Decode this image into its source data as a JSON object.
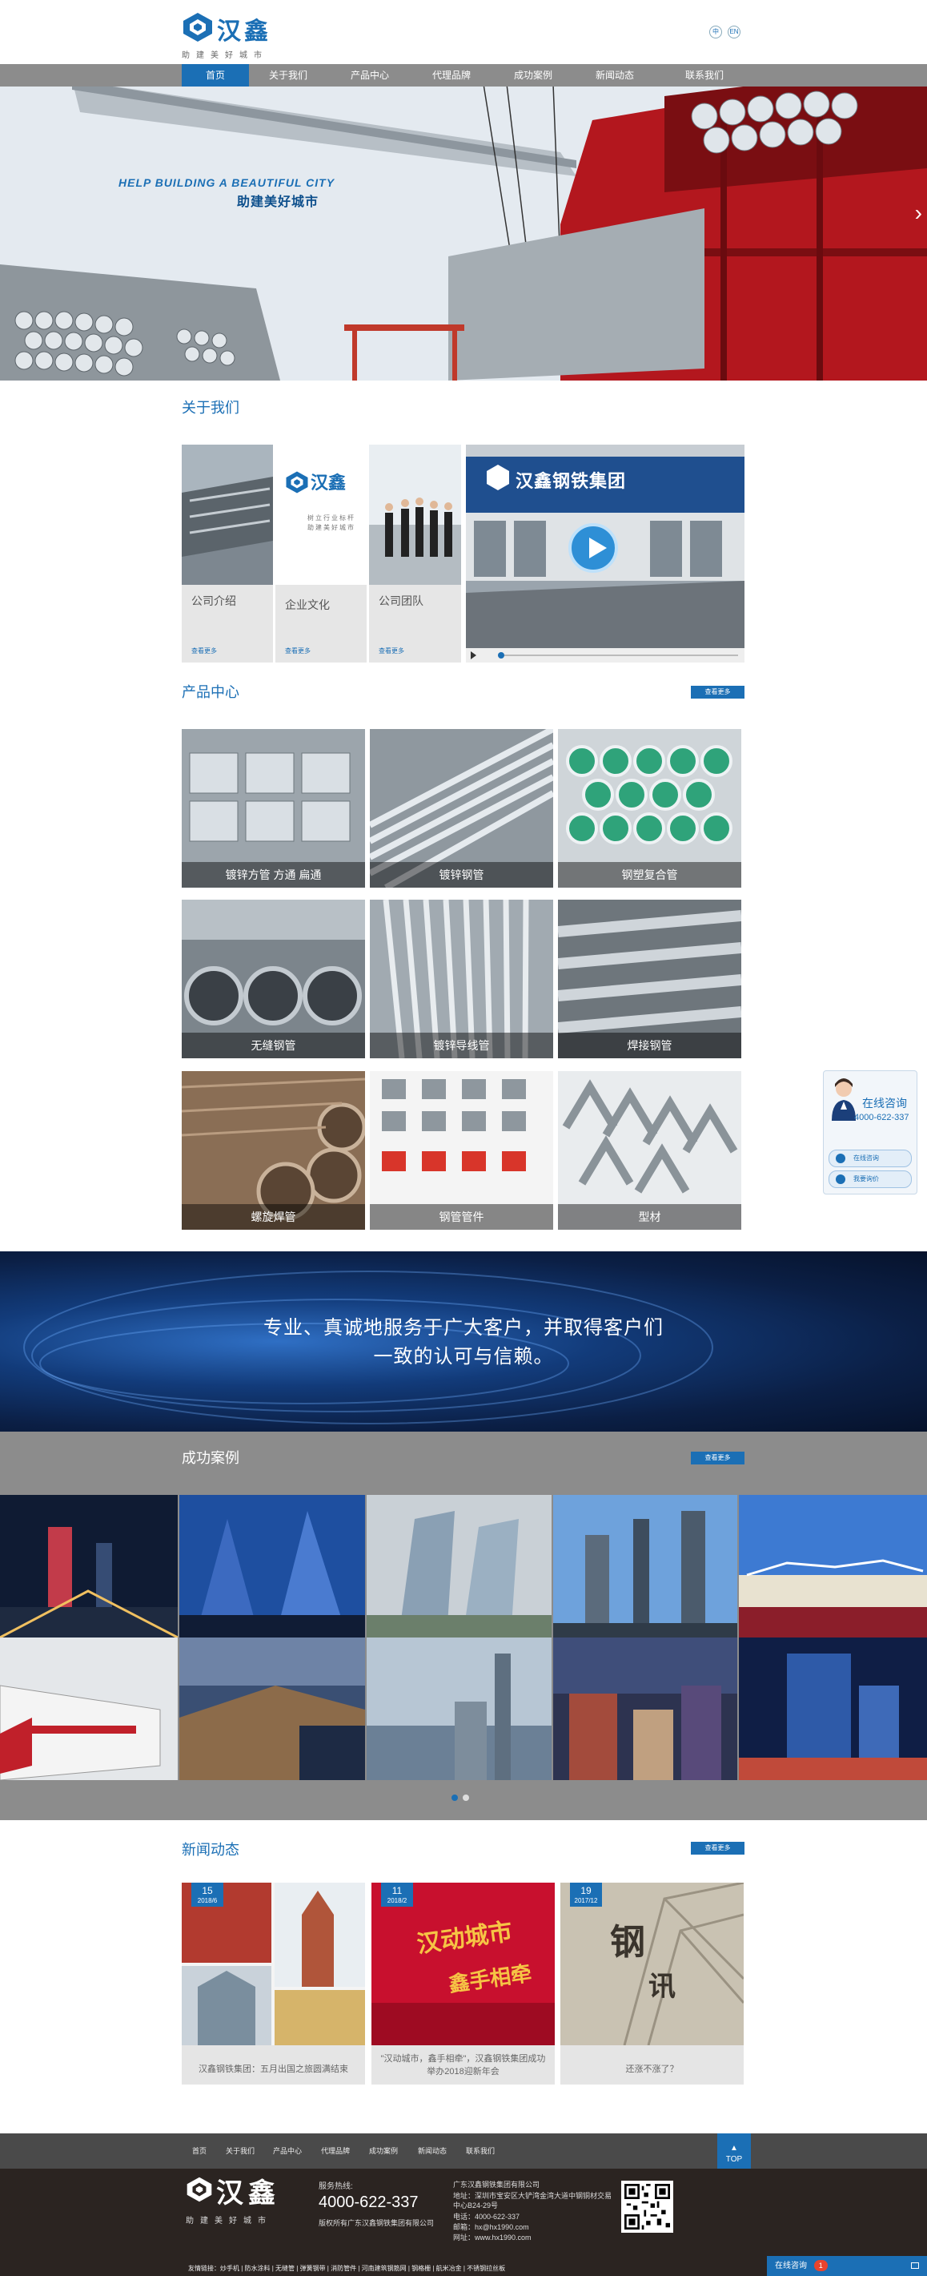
{
  "header": {
    "logo_text": "汉鑫",
    "logo_slogan": "助建美好城市",
    "lang_cn": "中",
    "lang_en": "EN"
  },
  "nav": [
    "首页",
    "关于我们",
    "产品中心",
    "代理品牌",
    "成功案例",
    "新闻动态",
    "联系我们"
  ],
  "banner": {
    "subtitle": "HELP BUILDING A BEAUTIFUL CITY",
    "title": "助建美好城市"
  },
  "about": {
    "title": "关于我们",
    "cards": [
      {
        "label": "公司介绍",
        "more": "查看更多"
      },
      {
        "label": "企业文化",
        "more": "查看更多"
      },
      {
        "label": "公司团队",
        "more": "查看更多"
      }
    ],
    "culture_logo": "汉鑫",
    "culture_slogan_1": "树立行业标杆",
    "culture_slogan_2": "助建美好城市",
    "video_sign": "汉鑫钢铁集团"
  },
  "products": {
    "title": "产品中心",
    "more": "查看更多",
    "items": [
      "镀锌方管 方通 扁通",
      "镀锌钢管",
      "钢塑复合管",
      "无缝钢管",
      "镀锌导线管",
      "焊接钢管",
      "螺旋焊管",
      "钢管管件",
      "型材"
    ]
  },
  "service": {
    "line1": "专业、真诚地服务于广大客户，并取得客户们",
    "line2": "一致的认可与信赖。"
  },
  "cases": {
    "title": "成功案例",
    "more": "查看更多"
  },
  "news": {
    "title": "新闻动态",
    "more": "查看更多",
    "items": [
      {
        "day": "15",
        "ym": "2018/6",
        "title": "汉鑫钢铁集团：五月出国之旅圆满结束"
      },
      {
        "day": "11",
        "ym": "2018/2",
        "title": "\"汉动城市，鑫手相牵\"，汉鑫钢铁集团成功举办2018迎新年会",
        "poster_1": "汉动城市",
        "poster_2": "鑫手相牵"
      },
      {
        "day": "19",
        "ym": "2017/12",
        "title": "还涨不涨了？",
        "poster_1": "钢",
        "poster_2": "讯"
      }
    ]
  },
  "footer": {
    "nav": [
      "首页",
      "关于我们",
      "产品中心",
      "代理品牌",
      "成功案例",
      "新闻动态",
      "联系我们"
    ],
    "top": "TOP",
    "logo_text": "汉鑫",
    "slogan": "助建美好城市",
    "hotline_label": "服务热线:",
    "hotline": "4000-622-337",
    "copyright": "版权所有广东汉鑫钢铁集团有限公司",
    "company": "广东汉鑫钢铁集团有限公司",
    "address_1": "地址：深圳市宝安区大铲湾金湾大道中钢铜材交易",
    "address_2": "中心B24-29号",
    "tel": "电话：4000-622-337",
    "email": "邮箱：hx@hx1990.com",
    "web": "网址：www.hx1990.com",
    "links": "友情链接：炒手机 | 防水涂料 | 无缝管 | 弹簧钢带 | 消防管件 | 河南建筑钢筋网 | 钢格栅 | 航米冶金 | 不锈钢拉丝板"
  },
  "consult": {
    "title": "在线咨询",
    "tel": "4000-622-337",
    "btn1": "在线咨询",
    "btn2": "我要询价",
    "chat_bar": "在线咨询",
    "chat_count": "1"
  }
}
